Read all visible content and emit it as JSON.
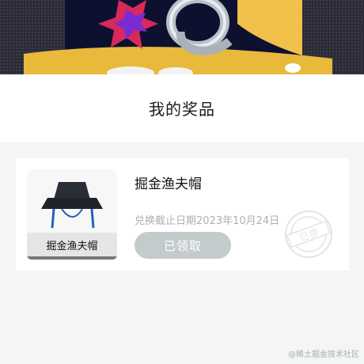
{
  "header": {
    "title": "我的奖品"
  },
  "prize": {
    "thumb_label": "掘金渔夫帽",
    "name": "掘金渔夫帽",
    "deadline": "兑换截止日期2023年10月24日",
    "claim_label": "已领取",
    "stamp_text": "已领"
  },
  "watermark": "@稀土掘金技术社区",
  "colors": {
    "page_background": "#f4f5f5",
    "card_background": "#ffffff",
    "button_disabled": "#c4cbcc",
    "muted_text": "#a8b0b5"
  }
}
